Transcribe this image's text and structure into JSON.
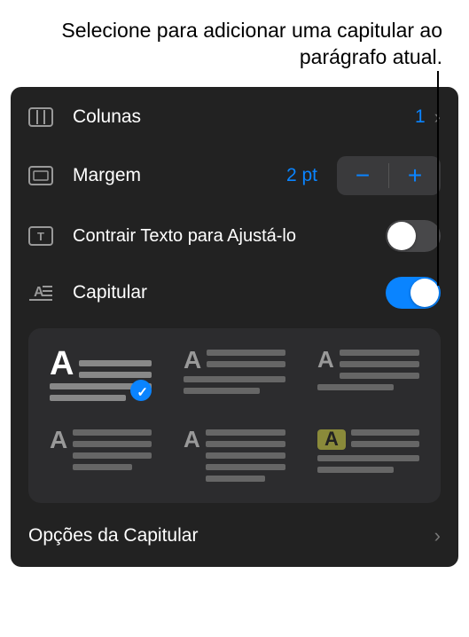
{
  "callout": {
    "text": "Selecione para adicionar uma capitular ao parágrafo atual."
  },
  "rows": {
    "columns": {
      "label": "Colunas",
      "value": "1"
    },
    "margin": {
      "label": "Margem",
      "value": "2 pt"
    },
    "shrink": {
      "label": "Contrair Texto para Ajustá-lo",
      "enabled": false
    },
    "dropcap": {
      "label": "Capitular",
      "enabled": true
    }
  },
  "styles": {
    "letter": "A",
    "options": [
      {
        "id": "raised-3line",
        "selected": true
      },
      {
        "id": "dropped-2line",
        "selected": false
      },
      {
        "id": "dropped-3line",
        "selected": false
      },
      {
        "id": "margin-2line",
        "selected": false
      },
      {
        "id": "margin-3line",
        "selected": false
      },
      {
        "id": "boxed",
        "selected": false
      }
    ]
  },
  "dropcap_options": {
    "label": "Opções da Capitular"
  },
  "colors": {
    "accent": "#0a84ff"
  }
}
